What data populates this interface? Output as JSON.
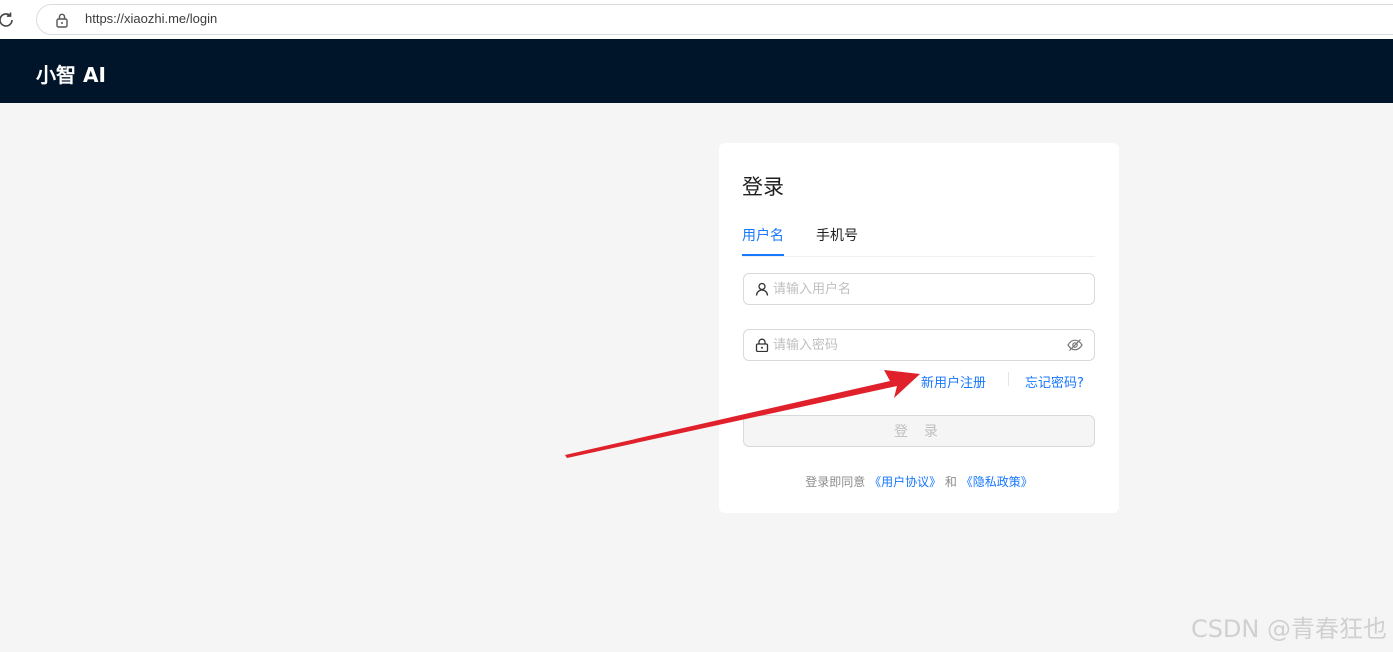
{
  "browser": {
    "url": "https://xiaozhi.me/login"
  },
  "header": {
    "logo": "小智 AI"
  },
  "login": {
    "title": "登录",
    "tabs": [
      {
        "label": "用户名",
        "active": true
      },
      {
        "label": "手机号",
        "active": false
      }
    ],
    "username_placeholder": "请输入用户名",
    "password_placeholder": "请输入密码",
    "register_link": "新用户注册",
    "forgot_link": "忘记密码?",
    "submit_label": "登 录",
    "agreement_prefix": "登录即同意",
    "user_agreement": "《用户协议》",
    "and_text": "和",
    "privacy_policy": "《隐私政策》"
  },
  "annotation": {
    "arrow_color": "#e0202a"
  },
  "watermark": "CSDN @青春狂也",
  "colors": {
    "header_bg": "#001529",
    "accent": "#1677ff",
    "page_bg": "#f5f5f5"
  }
}
